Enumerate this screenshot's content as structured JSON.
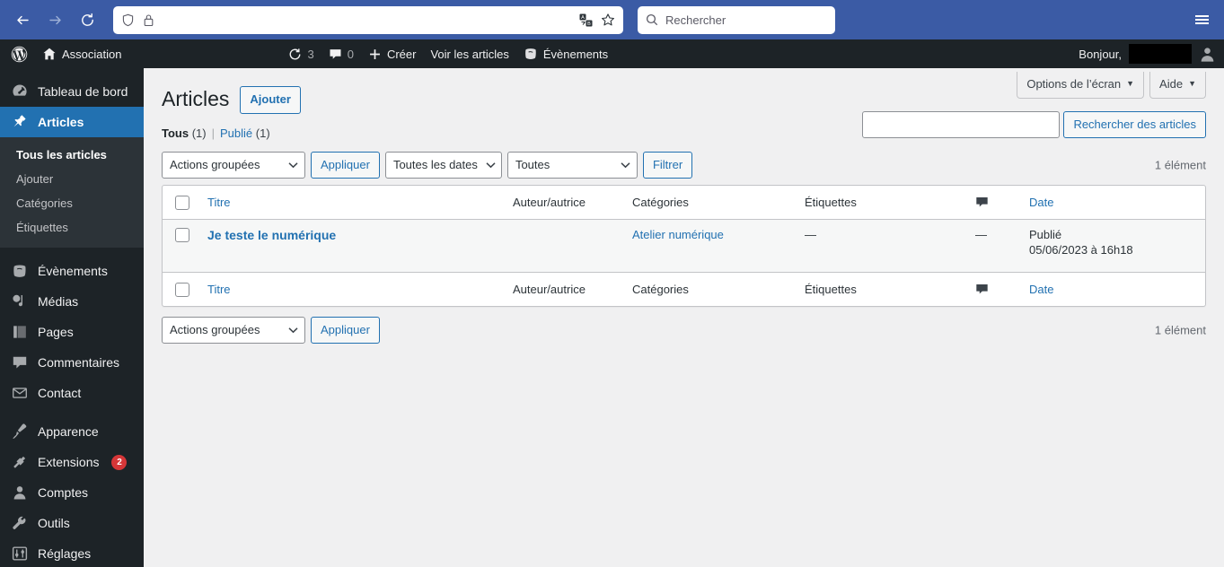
{
  "browser": {
    "back_icon": "back-arrow-icon",
    "forward_icon": "forward-arrow-icon",
    "reload_icon": "reload-icon",
    "url_value": "",
    "url_placeholder": "",
    "shield_icon": "shield-icon",
    "lock_icon": "padlock-icon",
    "translate_icon": "translate-icon",
    "bookmark_icon": "star-bookmark-icon",
    "search_placeholder": "Rechercher",
    "menu_icon": "hamburger-menu-icon"
  },
  "adminbar": {
    "wp_logo": "wordpress-logo-icon",
    "site_name": "Association",
    "site_icon": "home-icon",
    "updates_icon": "updates-icon",
    "updates_count": "3",
    "comments_icon": "comment-bubble-icon",
    "comments_count": "0",
    "new_icon": "plus-icon",
    "new_label": "Créer",
    "view_posts_label": "Voir les articles",
    "events_icon": "events-icon",
    "events_label": "Évènements",
    "greeting": "Bonjour,",
    "account_icon": "user-avatar-icon"
  },
  "sidebar": {
    "items": [
      {
        "label": "Tableau de bord",
        "icon": "dashboard-gauge-icon",
        "name": "dashboard",
        "current": false
      },
      {
        "label": "Articles",
        "icon": "pin-icon",
        "name": "posts",
        "current": true
      },
      {
        "label": "Évènements",
        "icon": "events-icon",
        "name": "events",
        "current": false
      },
      {
        "label": "Médias",
        "icon": "media-icon",
        "name": "media",
        "current": false
      },
      {
        "label": "Pages",
        "icon": "pages-icon",
        "name": "pages",
        "current": false
      },
      {
        "label": "Commentaires",
        "icon": "comment-bubble-icon",
        "name": "comments",
        "current": false
      },
      {
        "label": "Contact",
        "icon": "envelope-icon",
        "name": "contact",
        "current": false
      },
      {
        "label": "Apparence",
        "icon": "paintbrush-icon",
        "name": "appearance",
        "current": false
      },
      {
        "label": "Extensions",
        "icon": "plug-icon",
        "name": "plugins",
        "current": false,
        "badge": "2"
      },
      {
        "label": "Comptes",
        "icon": "user-icon",
        "name": "users",
        "current": false
      },
      {
        "label": "Outils",
        "icon": "wrench-icon",
        "name": "tools",
        "current": false
      },
      {
        "label": "Réglages",
        "icon": "settings-sliders-icon",
        "name": "settings",
        "current": false
      }
    ],
    "submenu": [
      {
        "label": "Tous les articles",
        "current": true
      },
      {
        "label": "Ajouter",
        "current": false
      },
      {
        "label": "Catégories",
        "current": false
      },
      {
        "label": "Étiquettes",
        "current": false
      }
    ]
  },
  "screen_meta": {
    "screen_options": "Options de l’écran",
    "help": "Aide",
    "caret": "▼"
  },
  "page": {
    "title": "Articles",
    "add_new": "Ajouter",
    "views": [
      {
        "label": "Tous",
        "count": "(1)",
        "current": true
      },
      {
        "label": "Publié",
        "count": "(1)",
        "current": false
      }
    ],
    "view_divider": "|",
    "search": {
      "value": "",
      "placeholder": "",
      "button": "Rechercher des articles"
    }
  },
  "tablenav_top": {
    "bulk_select": "Actions groupées",
    "apply": "Appliquer",
    "dates_select": "Toutes les dates",
    "cats_select": "Toutes",
    "filter": "Filtrer",
    "displaying_num": "1 élément"
  },
  "tablenav_bottom": {
    "bulk_select": "Actions groupées",
    "apply": "Appliquer",
    "displaying_num": "1 élément"
  },
  "table": {
    "columns": {
      "title": "Titre",
      "author": "Auteur/autrice",
      "categories": "Catégories",
      "tags": "Étiquettes",
      "comments_icon": "comment-bubble-icon",
      "date": "Date"
    },
    "rows": [
      {
        "title": "Je teste le numérique",
        "author": "",
        "categories": "Atelier numérique",
        "tags": "—",
        "comments": "—",
        "date_status": "Publié",
        "date_value": "05/06/2023 à 16h18"
      }
    ]
  },
  "colors": {
    "wp_blue": "#2271b1",
    "admin_dark": "#1d2327",
    "submenu_dark": "#2c3338",
    "browser_blue": "#3b5ba5",
    "badge_red": "#d63638",
    "page_bg": "#f0f0f1",
    "row_alt": "#f6f7f7"
  }
}
